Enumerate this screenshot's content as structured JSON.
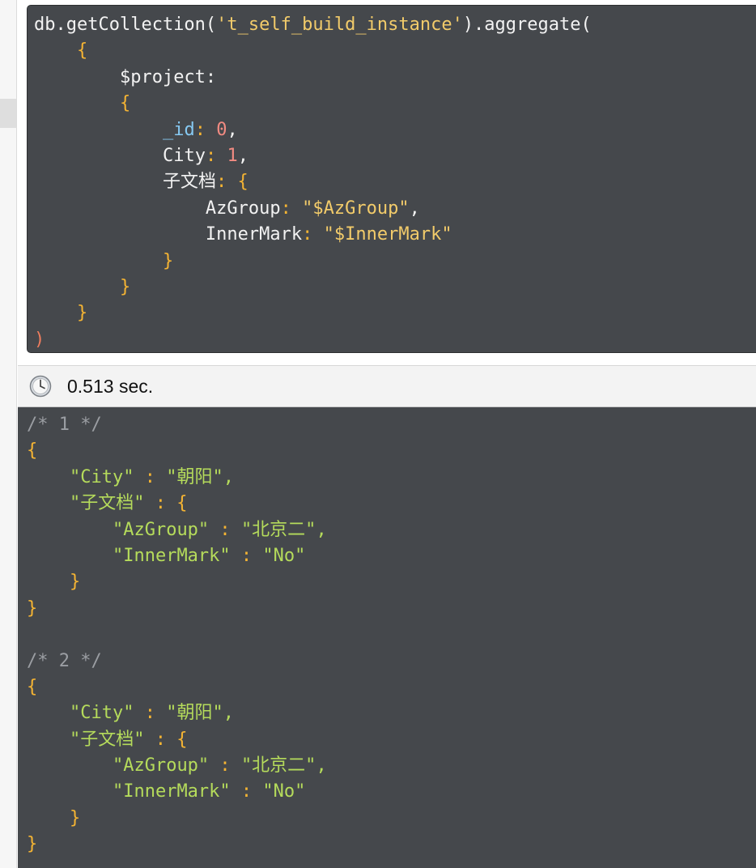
{
  "query": {
    "collection_call": "db.getCollection(",
    "collection_name": "'t_self_build_instance'",
    "method": ").aggregate(",
    "stage": "$project:",
    "fields": {
      "id_key": "_id",
      "id_val": "0",
      "city_key": "City",
      "city_val": "1",
      "sub_key": "子文档",
      "azgroup_key": "AzGroup",
      "azgroup_val": "\"$AzGroup\"",
      "innermark_key": "InnerMark",
      "innermark_val": "\"$InnerMark\""
    },
    "close_paren": ")"
  },
  "status": {
    "elapsed": "0.513 sec."
  },
  "results": [
    {
      "comment": "/* 1 */",
      "city_key": "\"City\"",
      "city_val": "\"朝阳\"",
      "sub_key": "\"子文档\"",
      "azgroup_key": "\"AzGroup\"",
      "azgroup_val": "\"北京二\"",
      "innermark_key": "\"InnerMark\"",
      "innermark_val": "\"No\""
    },
    {
      "comment": "/* 2 */",
      "city_key": "\"City\"",
      "city_val": "\"朝阳\"",
      "sub_key": "\"子文档\"",
      "azgroup_key": "\"AzGroup\"",
      "azgroup_val": "\"北京二\"",
      "innermark_key": "\"InnerMark\"",
      "innermark_val": "\"No\""
    }
  ],
  "colors": {
    "editor_bg": "#45484c",
    "string": "#f2cb6a",
    "brace": "#f5b433",
    "paren": "#ef7d5e",
    "number": "#f28b82",
    "key": "#86c9f2",
    "result_text": "#b5db5b",
    "comment": "#9b9ea3"
  },
  "icons": {
    "status": "clock-icon"
  }
}
